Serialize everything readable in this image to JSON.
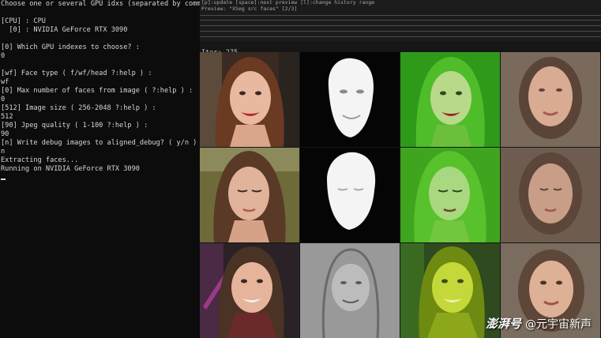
{
  "console": {
    "lines": [
      "Choose one or several GPU idxs (separated by comma).",
      "",
      "[CPU] : CPU",
      "  [0] : NVIDIA GeForce RTX 3090",
      "",
      "[0] Which GPU indexes to choose? :",
      "0",
      "",
      "[wf] Face type ( f/wf/head ?:help ) :",
      "wf",
      "[0] Max number of faces from image ( ?:help ) :",
      "0",
      "[512] Image size ( 256-2048 ?:help ) :",
      "512",
      "[90] Jpeg quality ( 1-100 ?:help ) :",
      "90",
      "[n] Write debug images to aligned_debug? ( y/n ) :",
      "n",
      "Extracting faces...",
      "Running on NVIDIA GeForce RTX 3090"
    ]
  },
  "preview": {
    "help_line": "[p]:update [space]:next preview [l]:change history range",
    "preview_line": "Preview: \"XSeg src faces\" [2/3]",
    "iter_text": "Iter: 275",
    "rows": [
      [
        "source-face-smiling",
        "mask-white-on-black",
        "green-overlay-face",
        "blurred-reconstruction"
      ],
      [
        "source-face-looking-down",
        "mask-white-on-black",
        "green-overlay-face",
        "blurred-reconstruction"
      ],
      [
        "source-face-smiling-tilted",
        "mask-noisy-gray",
        "green-overlay-face",
        "blurred-reconstruction"
      ]
    ]
  },
  "watermark": {
    "logo_text": "澎湃号",
    "handle_text": "@元宇宙新声"
  }
}
